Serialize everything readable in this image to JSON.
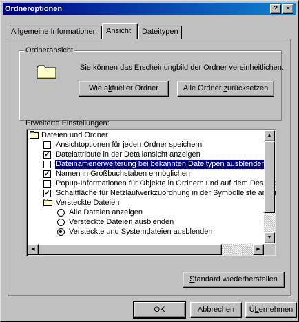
{
  "window": {
    "title": "Ordneroptionen",
    "help_label": "?",
    "close_label": "×"
  },
  "tabs": [
    {
      "label": "Allgemeine Informationen",
      "active": false
    },
    {
      "label": "Ansicht",
      "active": true
    },
    {
      "label": "Dateitypen",
      "active": false
    }
  ],
  "folder_view": {
    "group_label": "Ordneransicht",
    "description": "Sie können das Erscheinungbild der Ordner vereinheitlichen.",
    "like_current_pre": "Wie a",
    "like_current_u": "k",
    "like_current_post": "tueller Ordner",
    "reset_all_pre": "Alle Ordner ",
    "reset_all_u": "z",
    "reset_all_post": "urücksetzen"
  },
  "advanced": {
    "label": "Erweiterte Einstellungen:",
    "items": [
      {
        "kind": "folder",
        "label": "Dateien und Ordner"
      },
      {
        "kind": "checkbox",
        "checked": false,
        "label": "Ansichtoptionen für jeden Ordner speichern"
      },
      {
        "kind": "checkbox",
        "checked": true,
        "label": "Dateiattribute in der Detailansicht anzeigen"
      },
      {
        "kind": "checkbox",
        "checked": false,
        "label": "Dateinamenerweiterung bei bekannten Dateitypen ausblenden",
        "selected": true
      },
      {
        "kind": "checkbox",
        "checked": true,
        "label": "Namen in Großbuchstaben ermöglichen"
      },
      {
        "kind": "checkbox",
        "checked": false,
        "label": "Popup-Informationen für Objekte in Ordnern und auf dem Desktop a"
      },
      {
        "kind": "checkbox",
        "checked": true,
        "label": "Schaltfläche für Netzlaufwerkzuordnung in der Symbolleiste anzeige"
      },
      {
        "kind": "folder",
        "label": "Versteckte Dateien"
      },
      {
        "kind": "radio",
        "checked": false,
        "label": "Alle Dateien anzeigen"
      },
      {
        "kind": "radio",
        "checked": false,
        "label": "Versteckte Dateien ausblenden"
      },
      {
        "kind": "radio",
        "checked": true,
        "label": "Versteckte und Systemdateien ausblenden"
      }
    ],
    "restore_pre": "",
    "restore_u": "S",
    "restore_post": "tandard wiederherstellen"
  },
  "footer": {
    "ok": "OK",
    "cancel": "Abbrechen",
    "apply_pre": "Ü",
    "apply_u": "b",
    "apply_post": "ernehmen"
  },
  "colors": {
    "title_start": "#000080",
    "title_end": "#1084d0",
    "selection": "#000080",
    "face": "#c0c0c0"
  },
  "icons": [
    "folder-icon",
    "scroll-up-icon",
    "scroll-down-icon",
    "scroll-left-icon",
    "scroll-right-icon"
  ]
}
